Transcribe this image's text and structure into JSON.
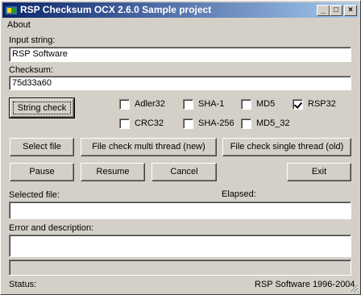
{
  "window": {
    "title": "RSP Checksum OCX 2.6.0 Sample project"
  },
  "title_buttons": {
    "minimize": "_",
    "maximize": "□",
    "close": "×"
  },
  "menu": {
    "about": "About"
  },
  "input": {
    "label": "Input string:",
    "value": "RSP Software"
  },
  "checksum": {
    "label": "Checksum:",
    "value": "75d33a60"
  },
  "buttons": {
    "string_check": "String check",
    "select_file": "Select file",
    "multi_thread": "File check multi thread (new)",
    "single_thread": "File check single thread (old)",
    "pause": "Pause",
    "resume": "Resume",
    "cancel": "Cancel",
    "exit": "Exit"
  },
  "algorithms": [
    {
      "label": "Adler32",
      "checked": false
    },
    {
      "label": "SHA-1",
      "checked": false
    },
    {
      "label": "MD5",
      "checked": false
    },
    {
      "label": "RSP32",
      "checked": true
    },
    {
      "label": "CRC32",
      "checked": false
    },
    {
      "label": "SHA-256",
      "checked": false
    },
    {
      "label": "MD5_32",
      "checked": false
    }
  ],
  "selected_file": {
    "label": "Selected file:",
    "value": ""
  },
  "elapsed": {
    "label": "Elapsed:"
  },
  "error": {
    "label": "Error and description:",
    "value": ""
  },
  "status": {
    "label": "Status:",
    "copyright": "RSP Software 1996-2004"
  }
}
